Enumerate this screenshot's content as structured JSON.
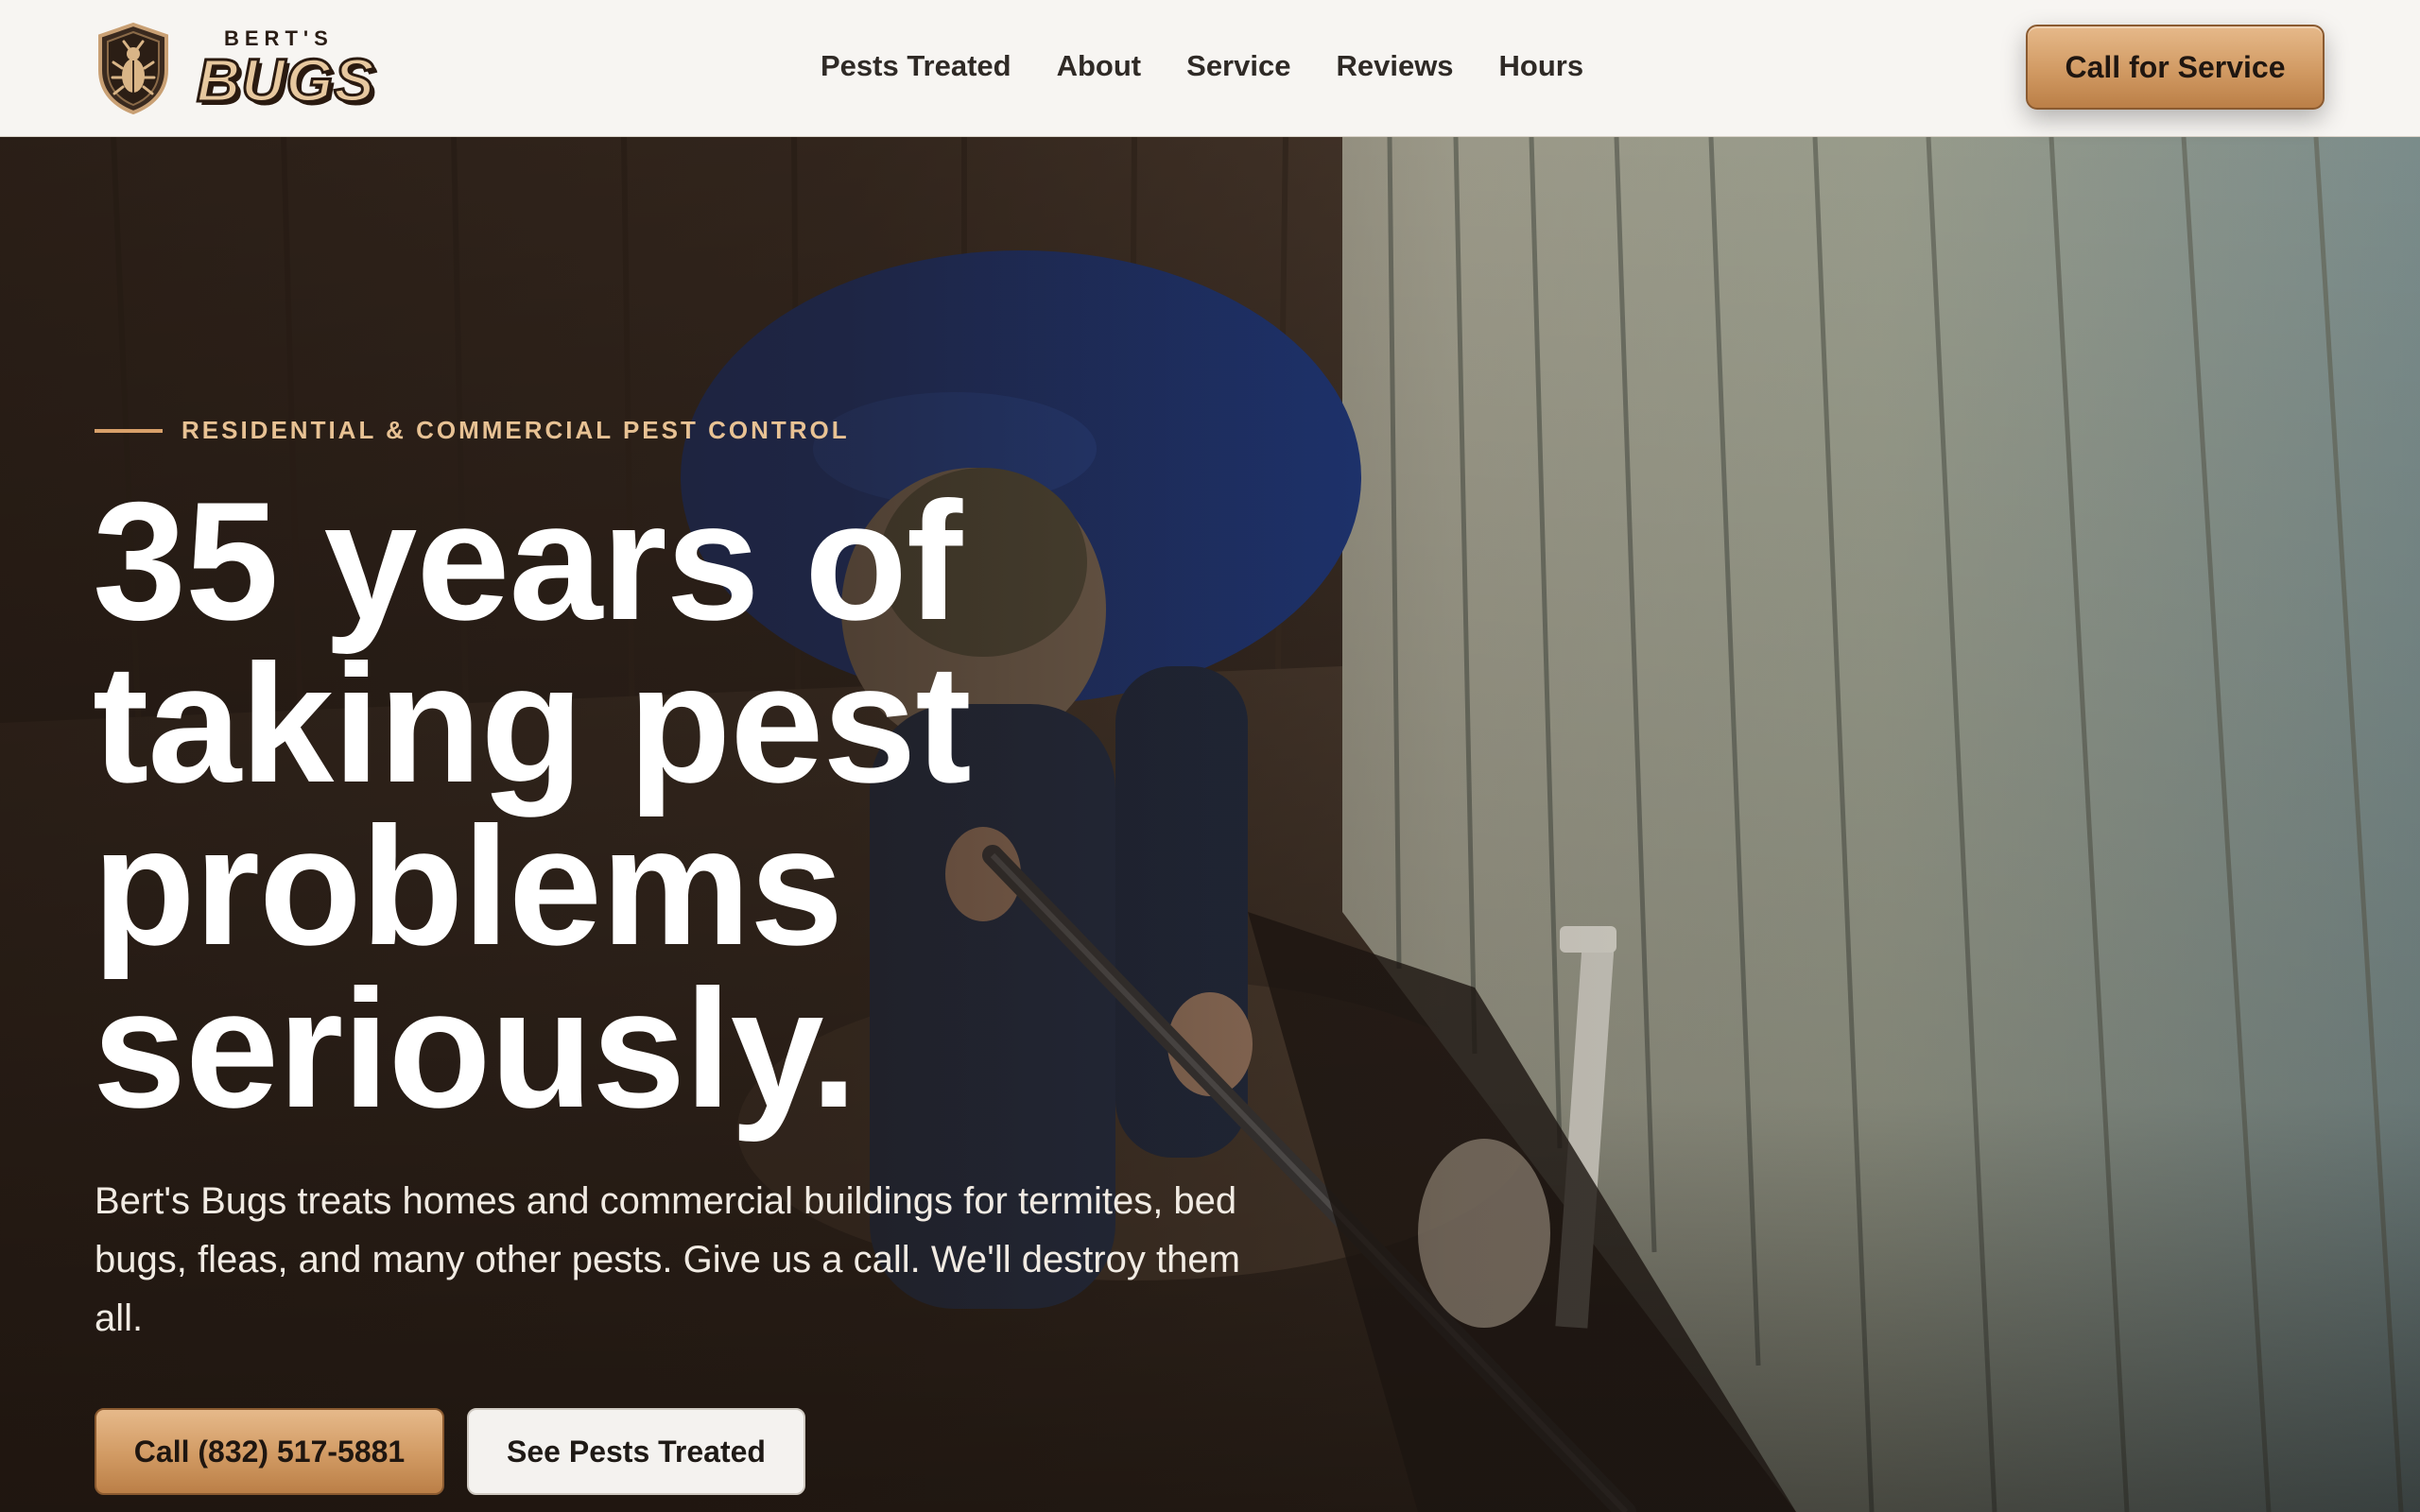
{
  "brand": {
    "small": "BERT'S",
    "big": "BUGS",
    "logo_icon": "bug-shield-icon"
  },
  "nav": {
    "items": [
      {
        "label": "Pests Treated"
      },
      {
        "label": "About"
      },
      {
        "label": "Service"
      },
      {
        "label": "Reviews"
      },
      {
        "label": "Hours"
      }
    ],
    "cta_label": "Call for Service"
  },
  "hero": {
    "eyebrow": "RESIDENTIAL & COMMERCIAL PEST CONTROL",
    "headline_lines": [
      "35 years of",
      "taking pest",
      "problems",
      "seriously."
    ],
    "subcopy": "Bert's Bugs treats homes and commercial buildings for termites, bed bugs, fleas, and many other pests. Give us a call. We'll destroy them all.",
    "primary_button": "Call (832) 517-5881",
    "secondary_button": "See Pests Treated"
  },
  "colors": {
    "accent": "#d19a63",
    "accent_light": "#e8c294",
    "header_bg": "#f7f5f2",
    "text_dark": "#2f2a26"
  }
}
